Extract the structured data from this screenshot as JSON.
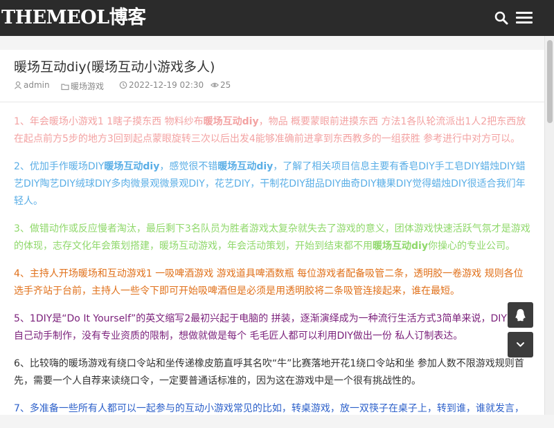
{
  "header": {
    "logo": "THEMEOL博客",
    "search_icon": "search-icon",
    "menu_icon": "hamburger-menu-icon"
  },
  "post": {
    "title": "暖场互动diy(暖场互动小游戏多人)",
    "author": "admin",
    "category": "暖场游戏",
    "date": "2022-12-19 02:30",
    "views": "25"
  },
  "paragraphs": [
    {
      "color": "#f3a2a2",
      "segments": [
        {
          "text": "1、年会暖场小游戏1 1瞎子摸东西 物料纱布",
          "bold": false
        },
        {
          "text": "暖场互动diy",
          "bold": true
        },
        {
          "text": "，物品 概要蒙眼前进摸东西 方法1各队轮流派出1人2把东西放在起点前方5步的地方3回到起点蒙眼旋转三次以后出发4能够准确前进拿到东西教多的一组获胜 参考进行中对方可以。",
          "bold": false
        }
      ]
    },
    {
      "color": "#5aaee6",
      "segments": [
        {
          "text": "2、优加手作暖场DIY",
          "bold": false
        },
        {
          "text": "暖场互动diy",
          "bold": true
        },
        {
          "text": "，感觉很不错",
          "bold": false
        },
        {
          "text": "暖场互动diy",
          "bold": true
        },
        {
          "text": "，了解了相关项目信息主要有香皂DIY手工皂DIY蜡烛DIY蜡艺DIY陶艺DIY绒球DIY多肉微景观微景观DIY，花艺DIY，干制花DIY甜品DIY曲奇DIY糖果DIY觉得蜡烛DIY很适合我们年轻人。",
          "bold": false
        }
      ]
    },
    {
      "color": "#8fd86a",
      "segments": [
        {
          "text": "3、做错动作或反应慢者淘汰，最后剩下3名队员为胜者游戏太复杂就失去了游戏的意义，团体游戏快速活跃气氛才是游戏的体现，志存文化年会策划搭建，暖场互动游戏，年会活动策划，开始到结束都不用",
          "bold": false
        },
        {
          "text": "暖场互动diy",
          "bold": true
        },
        {
          "text": "你操心的专业公司。",
          "bold": false
        }
      ]
    },
    {
      "color": "#e0701a",
      "segments": [
        {
          "text": "4、主持人开场暖场和互动游戏1 一吸啤酒游戏 游戏道具啤酒数瓶 每位游戏者配备吸管二条，透明胶一卷游戏 规则各位选手齐站于台前，主持人一些令下即可开始吸啤酒但是必须是用透明胶将二条吸管连接起来，谁在最短。",
          "bold": false
        }
      ]
    },
    {
      "color": "#7a1f7a",
      "segments": [
        {
          "text": "5、1DIY是“Do It Yourself”的英文缩写2最初兴起于电脑的 拼装，逐渐演绎成为一种流行生活方式3简单来说，DIY就是自己动手制作，没有专业资质的限制，想做就做是每个 毛毛匠人都可以利用DIY做出一份 私人订制表达。",
          "bold": false
        }
      ]
    },
    {
      "color": "#333333",
      "segments": [
        {
          "text": "6、比较嗨的暖场游戏有绕口令站和坐传递橡皮筋直呼其名吹“牛”比赛落地开花1绕口令站和坐 参加人数不限游戏规则首先，需要一个人自荐来读绕口令，一定要普通话标准的，因为这在游戏中是一个很有挑战性的。",
          "bold": false
        }
      ]
    },
    {
      "color": "#2b5fc9",
      "segments": [
        {
          "text": "7、多准备一些所有人都可以一起参与的互动小游戏常见的比如，转桌游戏，放一双筷子在桌子上，转到谁，谁就发言，",
          "bold": false
        }
      ]
    }
  ],
  "float_buttons": {
    "top_icon": "qq-penguin-icon",
    "bottom_icon": "chevron-down-icon"
  }
}
